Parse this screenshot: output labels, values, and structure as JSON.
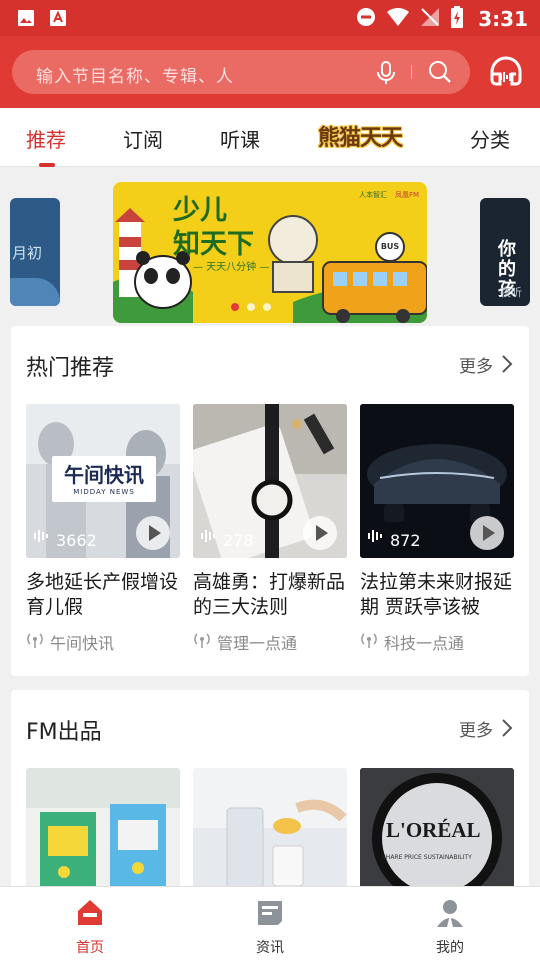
{
  "status_bar": {
    "time": "3:31"
  },
  "search": {
    "placeholder": "输入节目名称、专辑、人"
  },
  "tabs": [
    {
      "label": "推荐",
      "active": true
    },
    {
      "label": "订阅"
    },
    {
      "label": "听课"
    },
    {
      "label": "熊猫天天"
    },
    {
      "label": "分类"
    }
  ],
  "banner": {
    "title_line1": "少儿",
    "title_line2": "知天下",
    "subtitle": "— 天天八分钟 —",
    "logo1": "人本智汇",
    "logo2": "凤凰FM",
    "bus_label": "BUS",
    "side_left_text": "月初",
    "side_right_text": "你的孩",
    "side_right_sub": "夜听",
    "dots": 3,
    "active_dot": 0
  },
  "hot": {
    "title": "热门推荐",
    "more": "更多",
    "cards": [
      {
        "image_text": "午间快讯",
        "image_sub": "MIDDAY NEWS",
        "count": "3662",
        "title": "多地延长产假增设育儿假",
        "source": "午间快讯"
      },
      {
        "count": "278",
        "title": "高雄勇：打爆新品的三大法则",
        "source": "管理一点通"
      },
      {
        "count": "872",
        "title": "法拉第未来财报延期 贾跃亭该被",
        "source": "科技一点通"
      }
    ]
  },
  "fm": {
    "title": "FM出品",
    "more": "更多",
    "cards": [
      {
        "image_text": ""
      },
      {
        "image_text": ""
      },
      {
        "image_text": "L'ORÉAL",
        "image_sub": "SHARE PRICE  SUSTAINABILITY"
      }
    ]
  },
  "bottom_nav": [
    {
      "label": "首页",
      "icon": "home-icon",
      "active": true
    },
    {
      "label": "资讯",
      "icon": "news-icon"
    },
    {
      "label": "我的",
      "icon": "profile-icon"
    }
  ],
  "colors": {
    "brand_red": "#d6322d",
    "header_red": "#e03a34"
  }
}
